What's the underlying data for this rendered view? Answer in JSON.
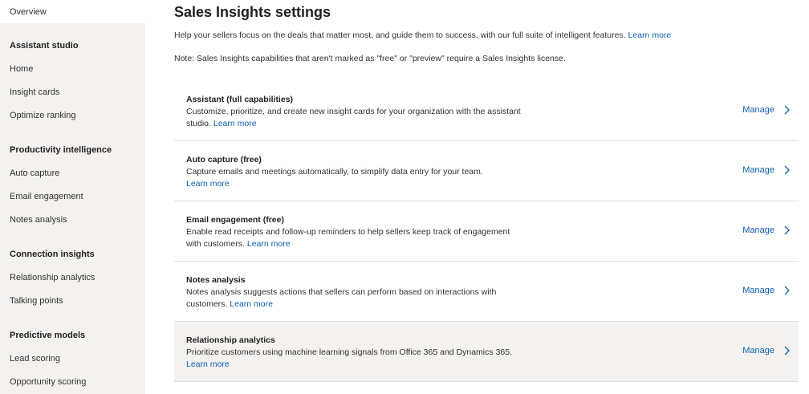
{
  "sidebar": {
    "top_item": "Overview",
    "groups": [
      {
        "title": "Assistant studio",
        "items": [
          "Home",
          "Insight cards",
          "Optimize ranking"
        ]
      },
      {
        "title": "Productivity intelligence",
        "items": [
          "Auto capture",
          "Email engagement",
          "Notes analysis"
        ]
      },
      {
        "title": "Connection insights",
        "items": [
          "Relationship analytics",
          "Talking points"
        ]
      },
      {
        "title": "Predictive models",
        "items": [
          "Lead scoring",
          "Opportunity scoring"
        ]
      }
    ]
  },
  "main": {
    "title": "Sales Insights settings",
    "intro": "Help your sellers focus on the deals that matter most, and guide them to success, with our full suite of intelligent features.",
    "intro_link": "Learn more",
    "note": "Note: Sales Insights capabilities that aren't marked as \"free\" or \"preview\" require a Sales Insights license.",
    "manage_label": "Manage",
    "learn_more": "Learn more",
    "cards": [
      {
        "title": "Assistant (full capabilities)",
        "desc": "Customize, prioritize, and create new insight cards for your organization with the assistant studio."
      },
      {
        "title": "Auto capture (free)",
        "desc": "Capture emails and meetings automatically, to simplify data entry for your team."
      },
      {
        "title": "Email engagement (free)",
        "desc": "Enable read receipts and follow-up reminders to help sellers keep track of engagement with customers."
      },
      {
        "title": "Notes analysis",
        "desc": "Notes analysis suggests actions that sellers can perform based on interactions with customers."
      },
      {
        "title": "Relationship analytics",
        "desc": "Prioritize customers using machine learning signals from Office 365 and Dynamics 365."
      }
    ]
  },
  "colors": {
    "link": "#0f5fb3",
    "sidebar_bg": "#f3f2f1",
    "highlight_row": "#f3f2f1"
  }
}
